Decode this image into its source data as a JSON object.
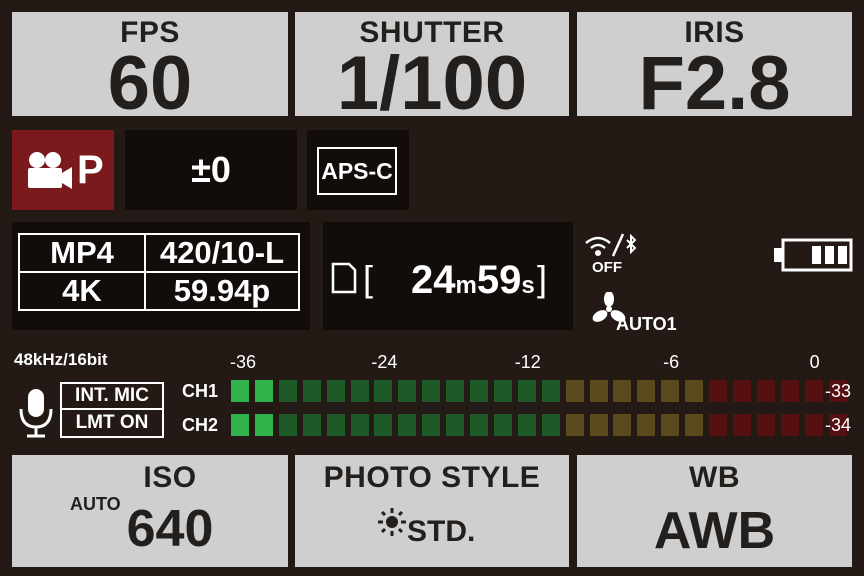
{
  "top_tiles": {
    "fps": {
      "label": "FPS",
      "value": "60"
    },
    "shutter": {
      "label": "SHUTTER",
      "value": "1/100"
    },
    "iris": {
      "label": "IRIS",
      "value": "F2.8"
    }
  },
  "mode": {
    "letter": "P",
    "exposure_comp": "±0",
    "crop_badge": "APS-C"
  },
  "recording": {
    "format": "MP4",
    "sampling": "420/10-L",
    "resolution": "4K",
    "frame_rate": "59.94p"
  },
  "remaining_time": {
    "minutes": "24",
    "minute_unit": "m",
    "seconds": "59",
    "second_unit": "s",
    "bracket_open": "[",
    "bracket_close": "]"
  },
  "wireless": {
    "status": "OFF"
  },
  "fan": {
    "mode": "AUTO1"
  },
  "battery": {
    "bars": 3
  },
  "audio": {
    "format": "48kHz/16bit",
    "mic_label": "INT. MIC",
    "limiter_label": "LMT ON",
    "scale": [
      "-36",
      "-24",
      "-12",
      "-6",
      "0"
    ],
    "channels": [
      {
        "name": "CH1",
        "peak": "-33",
        "lit_segments": 2
      },
      {
        "name": "CH2",
        "peak": "-34",
        "lit_segments": 2
      }
    ],
    "segment_count": 26,
    "green_segments": 14,
    "yellow_segments": 6,
    "red_segments": 6,
    "colors": {
      "green_lit": "#2fb24a",
      "green_dim": "#1d5a27",
      "yellow_dim": "#5a4a1c",
      "red_dim": "#561011"
    }
  },
  "bottom_tiles": {
    "iso": {
      "label": "ISO",
      "prefix": "AUTO",
      "value": "640"
    },
    "photo_style": {
      "label": "PHOTO STYLE",
      "value": "STD."
    },
    "wb": {
      "label": "WB",
      "value": "AWB"
    }
  },
  "colors": {
    "background": "#231915",
    "tile": "#cfcfcf",
    "mode_red": "#7a1a1c"
  }
}
